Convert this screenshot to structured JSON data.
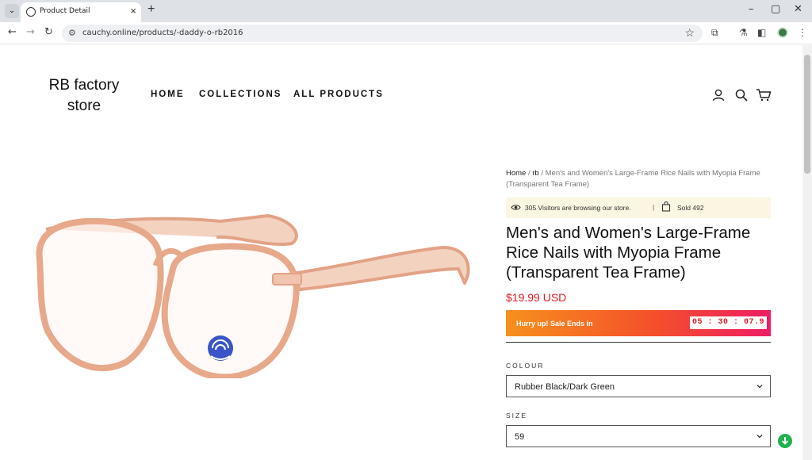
{
  "browser": {
    "tab_title": "Product Detail",
    "url": "cauchy.online/products/-daddy-o-rb2016"
  },
  "store": {
    "logo": "RB factory store",
    "nav": [
      "HOME",
      "COLLECTIONS",
      "ALL PRODUCTS"
    ]
  },
  "breadcrumb": {
    "home": "Home",
    "sep1": " / ",
    "rb": "rb",
    "sep2": " / ",
    "current": "Men's and Women's Large-Frame Rice Nails with Myopia Frame (Transparent Tea Frame)"
  },
  "visitors": {
    "text": "305 Visitors are browsing our store.",
    "separator": "|",
    "sold": "Sold 492"
  },
  "product": {
    "title": "Men's and Women's Large-Frame Rice Nails with Myopia Frame (Transparent Tea Frame)",
    "price": "$19.99 USD"
  },
  "sale": {
    "text": "Hurry up! Sale Ends in",
    "timer": "05 : 30 : 07.9"
  },
  "options": {
    "colour_label": "COLOUR",
    "colour_value": "Rubber Black/Dark Green",
    "size_label": "SIZE",
    "size_value": "59"
  },
  "colors": {
    "price": "#e31b23",
    "sale_gradient_start": "#f7901e",
    "sale_gradient_end": "#ee1c64",
    "frame": "#eaa98b"
  }
}
